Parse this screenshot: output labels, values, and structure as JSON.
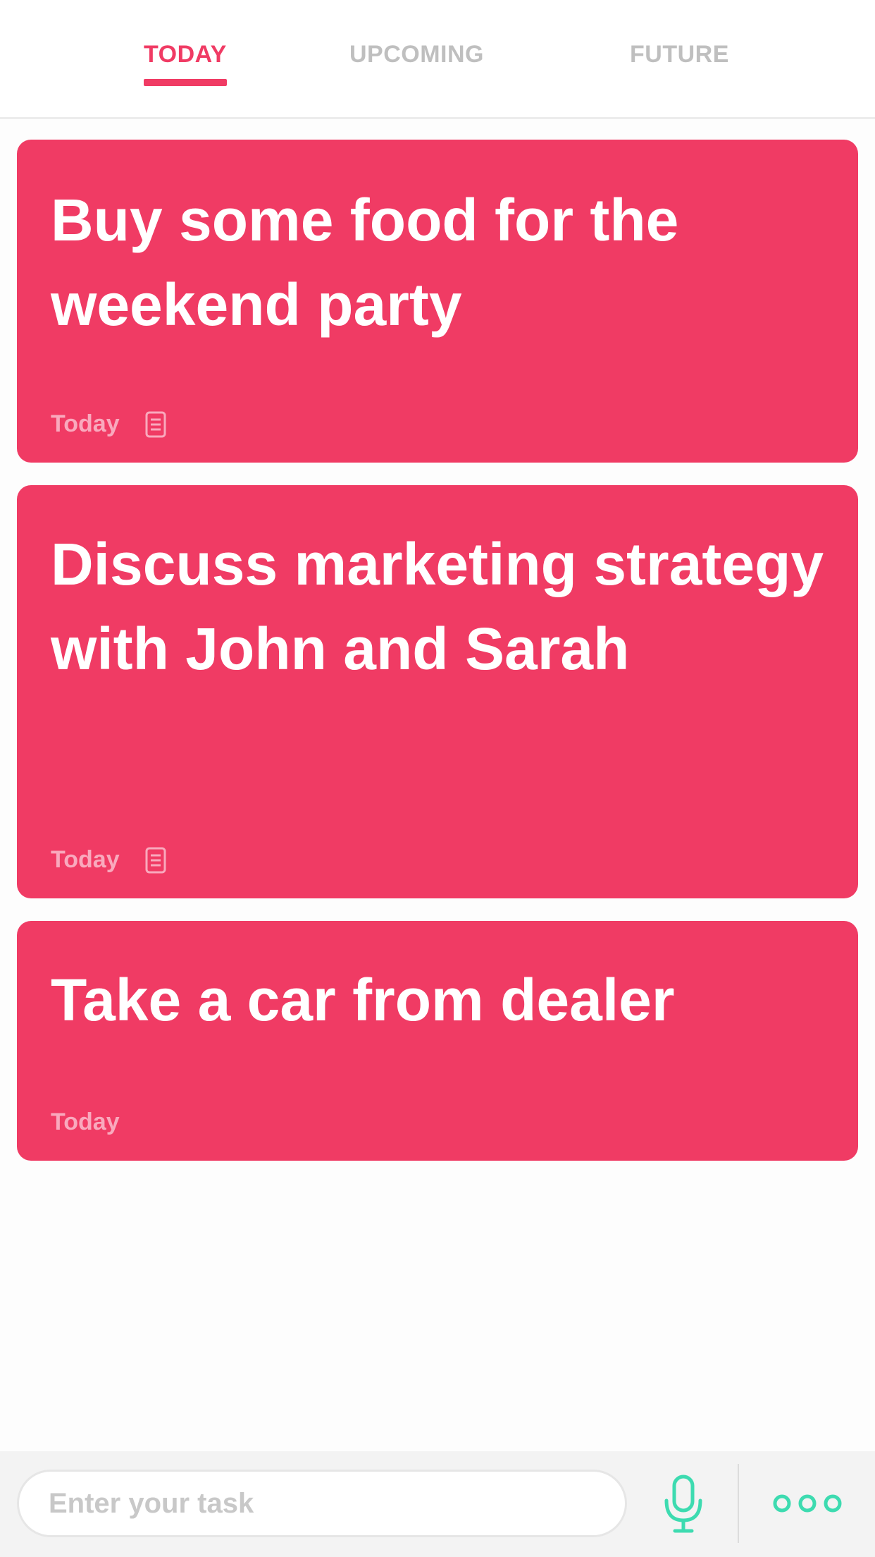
{
  "tabs": [
    {
      "label": "TODAY",
      "active": true
    },
    {
      "label": "UPCOMING",
      "active": false
    },
    {
      "label": "FUTURE",
      "active": false
    }
  ],
  "tasks": [
    {
      "title": "Buy some food for the weekend party",
      "due": "Today",
      "has_note": true
    },
    {
      "title": "Discuss marketing strategy with John and Sarah",
      "due": "Today",
      "has_note": true
    },
    {
      "title": "Take a car from dealer",
      "due": "Today",
      "has_note": false
    }
  ],
  "input": {
    "placeholder": "Enter your task",
    "value": ""
  },
  "icons": {
    "note": "note-icon",
    "mic": "microphone-icon",
    "more": "more-icon"
  },
  "colors": {
    "accent": "#f03b64",
    "mic": "#3ddbb0",
    "tab_inactive": "#bfbfbf"
  }
}
